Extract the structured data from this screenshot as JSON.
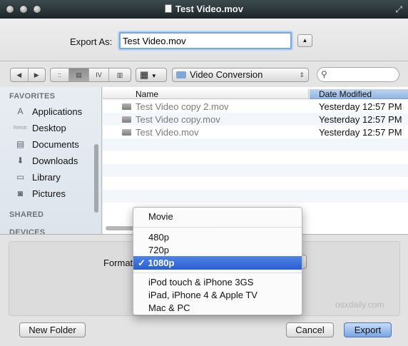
{
  "window": {
    "title": "Test Video.mov"
  },
  "export": {
    "label": "Export As:",
    "filename": "Test Video.mov"
  },
  "toolbar": {
    "current_folder": "Video Conversion",
    "view_cols_glyph": "IV",
    "search_placeholder": ""
  },
  "sidebar": {
    "favorites_header": "FAVORITES",
    "shared_header": "SHARED",
    "devices_header": "DEVICES",
    "items": [
      {
        "label": "Applications",
        "icon": "applications-icon"
      },
      {
        "label": "Desktop",
        "icon": "desktop-icon"
      },
      {
        "label": "Documents",
        "icon": "documents-icon"
      },
      {
        "label": "Downloads",
        "icon": "downloads-icon"
      },
      {
        "label": "Library",
        "icon": "folder-icon"
      },
      {
        "label": "Pictures",
        "icon": "pictures-icon"
      }
    ],
    "desktop_tiny_text": "Retotr"
  },
  "filelist": {
    "col_name": "Name",
    "col_date": "Date Modified",
    "rows": [
      {
        "name": "Test Video copy 2.mov",
        "date": "Yesterday 12:57 PM"
      },
      {
        "name": "Test Video copy.mov",
        "date": "Yesterday 12:57 PM"
      },
      {
        "name": "Test Video.mov",
        "date": "Yesterday 12:57 PM"
      }
    ]
  },
  "format": {
    "label": "Format",
    "menu": [
      "Movie",
      "480p",
      "720p",
      "1080p",
      "iPod touch & iPhone 3GS",
      "iPad, iPhone 4 & Apple TV",
      "Mac & PC"
    ],
    "selected": "1080p",
    "check": "✓"
  },
  "buttons": {
    "new_folder": "New Folder",
    "cancel": "Cancel",
    "export": "Export"
  },
  "watermark": "osxdaily.com",
  "colors": {
    "selection": "#3b6fd9",
    "sort_header": "#9dbbe6"
  }
}
